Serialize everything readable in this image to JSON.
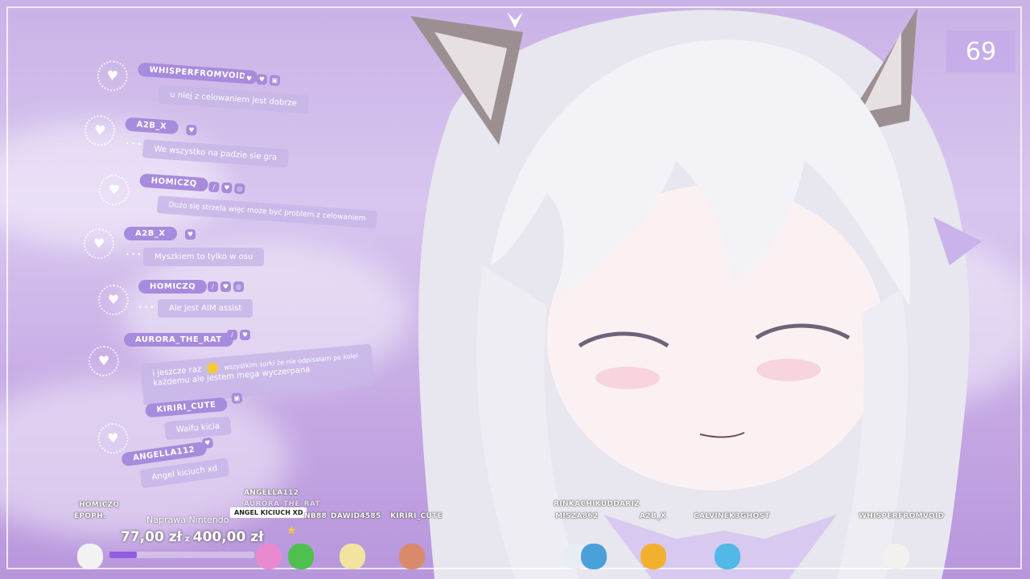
{
  "counter": {
    "value": "69"
  },
  "chat": [
    {
      "user": "WHISPERFROMVOID",
      "badges": [
        "heart",
        "heart",
        "clip"
      ],
      "text": "u niej z celowaniem jest dobrze"
    },
    {
      "user": "A2B_X",
      "badges": [
        "heart"
      ],
      "text": "We wszystko na padzie sie gra"
    },
    {
      "user": "HOMICZQ",
      "badges": [
        "sword",
        "heart",
        "mic"
      ],
      "text": "Dużo się strzela więc może być problem z celowaniem"
    },
    {
      "user": "A2B_X",
      "badges": [
        "heart"
      ],
      "text": "Myszkiem to tylko w osu"
    },
    {
      "user": "HOMICZQ",
      "badges": [
        "sword",
        "heart",
        "mic"
      ],
      "text": "Ale jest AIM assist"
    },
    {
      "user": "AURORA_THE_RAT",
      "badges": [
        "sword",
        "heart"
      ],
      "text_line1_a": "i jeszcze raz",
      "text_line1_b": "wszystkim sorki że nie odpisałam po kolei",
      "text_line2": "każdemu ale jestem mega wyczerpana"
    },
    {
      "user": "KIRIRI_CUTE",
      "badges": [
        "clip"
      ],
      "text": "Waifu kicia"
    },
    {
      "user": "ANGELLA112",
      "badges": [
        "heart"
      ],
      "text": "Angel kiciuch xd"
    }
  ],
  "goal": {
    "title": "Naprawa Nintendo",
    "current": "77,00 zł",
    "separator": "z",
    "target": "400,00 zł",
    "progress": 0.19
  },
  "bottom_users": {
    "homiczq": "HOMICZQ",
    "epoph": "EPOPH.",
    "angella112": "ANGELLA112",
    "aurora": "AURORA_THE_RAT",
    "tooltip": "ANGEL KICIUCH XD",
    "nb88": "NB88",
    "dawid": "DAWID4585",
    "kiriri": "KIRIRI_CUTE",
    "rinka": "RINKACHIKUDDARIZ",
    "misza": "MISZA862",
    "a2b": "A2B_X",
    "calvinek": "CALVINEK3GHOST",
    "whisper": "WHISPERFROMVOID"
  },
  "colors": {
    "accent": "#a78bdc",
    "bar_fill": "#8f5de0"
  }
}
